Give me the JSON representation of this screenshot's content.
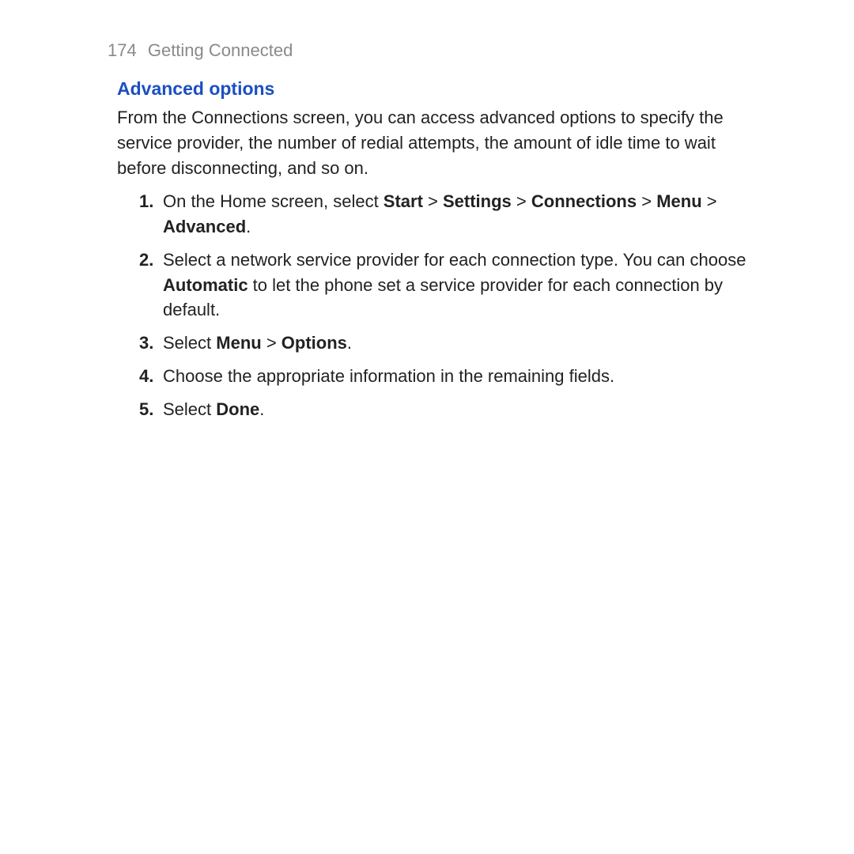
{
  "header": {
    "page_number": "174",
    "chapter": "Getting Connected"
  },
  "section": {
    "heading": "Advanced options",
    "intro": "From the Connections screen, you can access advanced options to specify the service provider, the number of redial attempts, the amount of idle time to wait before disconnecting, and so on."
  },
  "steps": [
    {
      "num": "1.",
      "parts": [
        {
          "t": "On the Home screen, select ",
          "b": false
        },
        {
          "t": "Start",
          "b": true
        },
        {
          "t": " > ",
          "b": false
        },
        {
          "t": "Settings",
          "b": true
        },
        {
          "t": " > ",
          "b": false
        },
        {
          "t": "Connections",
          "b": true
        },
        {
          "t": " > ",
          "b": false
        },
        {
          "t": "Menu",
          "b": true
        },
        {
          "t": " > ",
          "b": false
        },
        {
          "t": "Advanced",
          "b": true
        },
        {
          "t": ".",
          "b": false
        }
      ]
    },
    {
      "num": "2.",
      "parts": [
        {
          "t": "Select a network service provider for each connection type. You can choose ",
          "b": false
        },
        {
          "t": "Automatic",
          "b": true
        },
        {
          "t": " to let the phone set a service provider for each connection by default.",
          "b": false
        }
      ]
    },
    {
      "num": "3.",
      "parts": [
        {
          "t": "Select ",
          "b": false
        },
        {
          "t": "Menu",
          "b": true
        },
        {
          "t": " > ",
          "b": false
        },
        {
          "t": "Options",
          "b": true
        },
        {
          "t": ".",
          "b": false
        }
      ]
    },
    {
      "num": "4.",
      "parts": [
        {
          "t": "Choose the appropriate information in the remaining fields.",
          "b": false
        }
      ]
    },
    {
      "num": "5.",
      "parts": [
        {
          "t": "Select ",
          "b": false
        },
        {
          "t": "Done",
          "b": true
        },
        {
          "t": ".",
          "b": false
        }
      ]
    }
  ]
}
